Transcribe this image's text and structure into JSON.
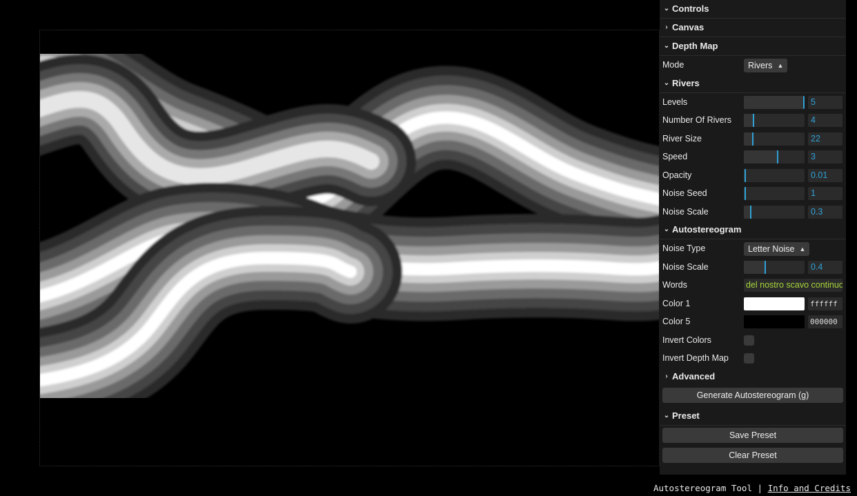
{
  "gui": {
    "controls_title": "Controls",
    "canvas_title": "Canvas",
    "depth_map": {
      "title": "Depth Map",
      "mode_label": "Mode",
      "mode_value": "Rivers"
    },
    "rivers": {
      "title": "Rivers",
      "params": [
        {
          "label": "Levels",
          "value": "5",
          "slider_pct": 100
        },
        {
          "label": "Number Of Rivers",
          "value": "4",
          "slider_pct": 15
        },
        {
          "label": "River Size",
          "value": "22",
          "slider_pct": 14
        },
        {
          "label": "Speed",
          "value": "3",
          "slider_pct": 55
        },
        {
          "label": "Opacity",
          "value": "0.01",
          "slider_pct": 1
        },
        {
          "label": "Noise Seed",
          "value": "1",
          "slider_pct": 1
        },
        {
          "label": "Noise Scale",
          "value": "0.3",
          "slider_pct": 10
        }
      ]
    },
    "autostereogram": {
      "title": "Autostereogram",
      "noise_type_label": "Noise Type",
      "noise_type_value": "Letter Noise",
      "noise_scale_label": "Noise Scale",
      "noise_scale_value": "0.4",
      "noise_scale_pct": 34,
      "words_label": "Words",
      "words_value": "del nostro scavo continuo",
      "color1_label": "Color 1",
      "color1_value": "ffffff",
      "color1_hex": "#ffffff",
      "color5_label": "Color 5",
      "color5_value": "000000",
      "color5_hex": "#000000",
      "invert_colors_label": "Invert Colors",
      "invert_depth_label": "Invert Depth Map",
      "advanced_title": "Advanced",
      "generate_label": "Generate Autostereogram (g)"
    },
    "preset": {
      "title": "Preset",
      "save_label": "Save Preset",
      "clear_label": "Clear Preset"
    }
  },
  "footer": {
    "app_name": "Autostereogram Tool",
    "separator": "|",
    "info_link": "Info and Credits"
  },
  "colors": {
    "accent": "#2fa1d6",
    "text_input": "#a6d33a",
    "panel_bg": "#1a1a1a"
  }
}
